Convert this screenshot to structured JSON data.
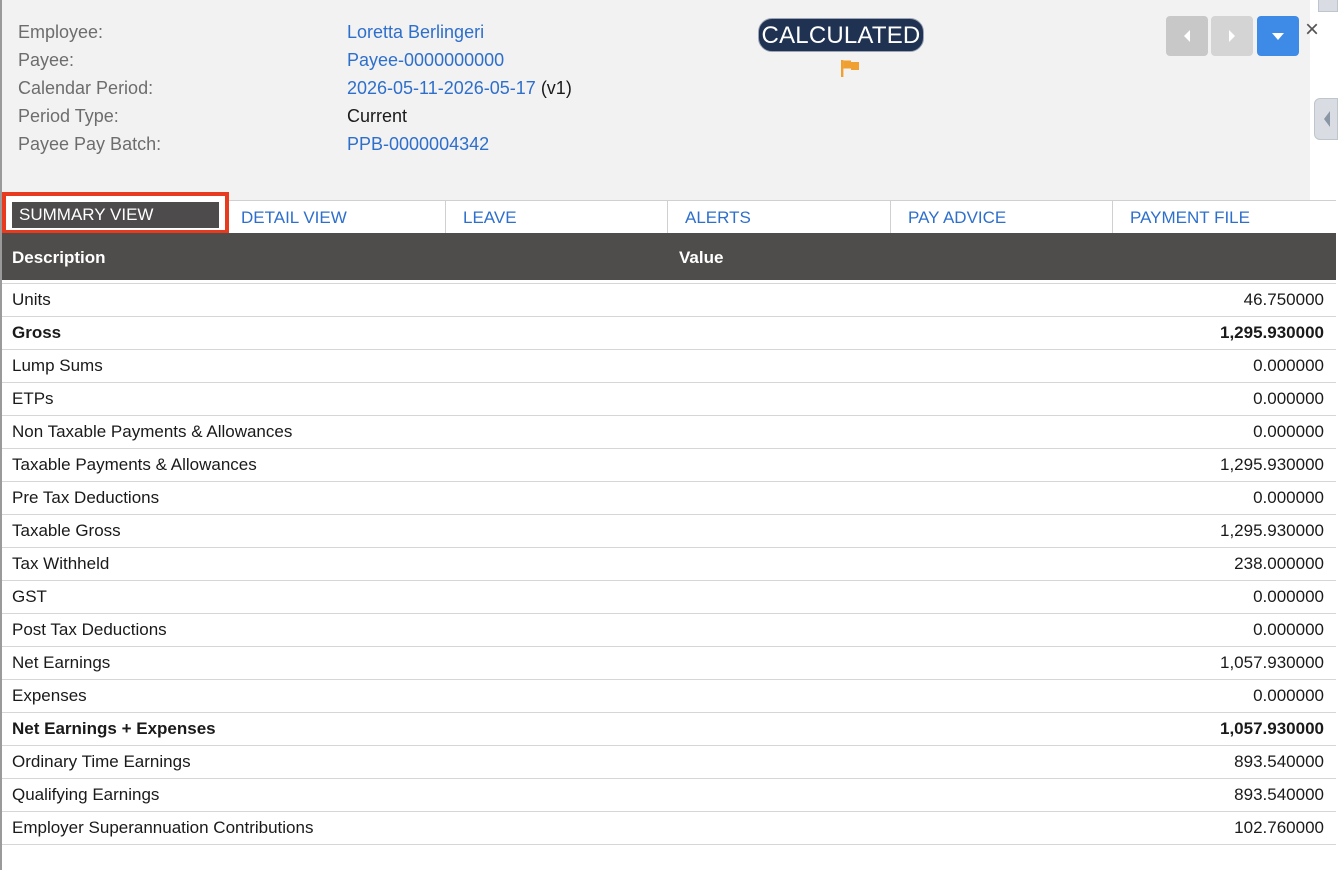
{
  "header": {
    "fields": [
      {
        "label": "Employee:",
        "value": "Loretta Berlingeri",
        "link": true
      },
      {
        "label": "Payee:",
        "value": "Payee-0000000000",
        "link": true
      },
      {
        "label": "Calendar Period:",
        "value": "2026-05-11-2026-05-17",
        "suffix": " (v1)",
        "link": true
      },
      {
        "label": "Period Type:",
        "value": "Current",
        "link": false
      },
      {
        "label": "Payee Pay Batch:",
        "value": "PPB-0000004342",
        "link": true
      }
    ],
    "status": "CALCULATED",
    "flag_icon": "flag-icon",
    "flag_color": "#f0a030",
    "close_symbol": "×"
  },
  "colors": {
    "link": "#2e6fcc",
    "badge_bg": "#1f3252",
    "table_header_bg": "#4f4d4c",
    "active_tab_outline": "#e83a1f",
    "menu_button": "#3d8be6"
  },
  "tabs": [
    {
      "label": "SUMMARY VIEW",
      "active": true
    },
    {
      "label": "DETAIL VIEW"
    },
    {
      "label": "LEAVE"
    },
    {
      "label": "ALERTS"
    },
    {
      "label": "PAY ADVICE"
    },
    {
      "label": "PAYMENT FILE"
    }
  ],
  "table": {
    "columns": [
      "Description",
      "Value"
    ],
    "rows": [
      {
        "description": "Units",
        "value": "46.750000"
      },
      {
        "description": "Gross",
        "value": "1,295.930000",
        "bold": true
      },
      {
        "description": "Lump Sums",
        "value": "0.000000"
      },
      {
        "description": "ETPs",
        "value": "0.000000"
      },
      {
        "description": "Non Taxable Payments & Allowances",
        "value": "0.000000"
      },
      {
        "description": "Taxable Payments & Allowances",
        "value": "1,295.930000"
      },
      {
        "description": "Pre Tax Deductions",
        "value": "0.000000"
      },
      {
        "description": "Taxable Gross",
        "value": "1,295.930000"
      },
      {
        "description": "Tax Withheld",
        "value": "238.000000"
      },
      {
        "description": "GST",
        "value": "0.000000"
      },
      {
        "description": "Post Tax Deductions",
        "value": "0.000000"
      },
      {
        "description": "Net Earnings",
        "value": "1,057.930000"
      },
      {
        "description": "Expenses",
        "value": "0.000000"
      },
      {
        "description": "Net Earnings + Expenses",
        "value": "1,057.930000",
        "bold": true
      },
      {
        "description": "Ordinary Time Earnings",
        "value": "893.540000"
      },
      {
        "description": "Qualifying Earnings",
        "value": "893.540000"
      },
      {
        "description": "Employer Superannuation Contributions",
        "value": "102.760000"
      }
    ]
  }
}
